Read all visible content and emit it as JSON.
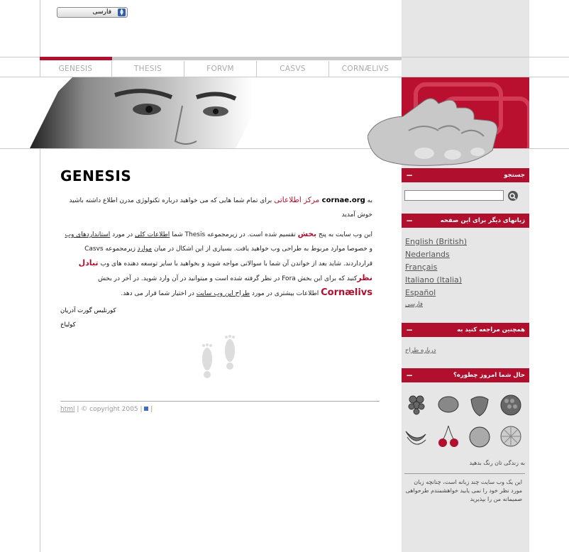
{
  "language_select": {
    "value": "فارسی"
  },
  "nav": {
    "items": [
      {
        "label": "GENESIS",
        "active": true
      },
      {
        "label": "THESIS",
        "active": false
      },
      {
        "label": "FORVM",
        "active": false
      },
      {
        "label": "CASVS",
        "active": false
      },
      {
        "label": "CORNÆLIVS",
        "active": false
      }
    ]
  },
  "main": {
    "title": "GENESIS",
    "intro": {
      "prefix": "به ",
      "site": "cornae.org",
      "red": " مرکز اطلاعاتی",
      "rest": " برای تمام شما هایی که می خواهید درباره تکنولوژی مدرن اطلاع داشته باشید خوش آمدید"
    },
    "p1": {
      "a": "این وب سایت به پنج ",
      "red1": "بخش",
      "b": " تقسیم شده است.  در زیرمجموعه Thesis شما ",
      "link1": "اطلاعات کلی",
      "c": " در مورد ",
      "link2": "استانداردهای وب",
      "d": " و خصوصا موارد مربوط به طراحی وب خواهید یافت. بسیاری از این اشکال در میان ",
      "link3": "موارد",
      "e": " زیرمجموعه Casvs قرارداردند. شاید بعد از خواندن آن شما با سوالاتی مواجه شوید و بخواهید با سایر توسعه دهنده های وب ",
      "red2": "تبادل نظر",
      "f": "کنید که برای این بخش Fora در نظر گرفته شده است و میتوانید در آن وارد شوید. در آخر در بخش ",
      "red3": "Cornælivs",
      "g": " اطلاعات بیشتری در مورد ",
      "link4": "طراح این وب سایت",
      "h": " در اختیار شما قرار می دهد."
    },
    "signature": "کورنلیس گورت آدریان کولباخ",
    "footer": {
      "html": "html",
      "copyright": "© copyright 2005"
    }
  },
  "sidebar": {
    "search": {
      "title": "جستجو",
      "placeholder": ""
    },
    "languages": {
      "title": "زبانهای دیگر برای این صفحه",
      "items": [
        "English (British)",
        "Nederlands",
        "Français",
        "Italiano (Italia)",
        "Español",
        "فارسی"
      ]
    },
    "see_also": {
      "title": "همچنین مراجعه کنید به",
      "link": "درباره طراح"
    },
    "mood": {
      "title": "حال شما امروز چطوره؟",
      "fruits": [
        "grapes-icon",
        "lemon-icon",
        "strawberry-icon",
        "raspberry-icon",
        "bananas-icon",
        "cherries-icon",
        "peach-icon",
        "orange-slice-icon"
      ],
      "caption": "به زندگی تان رنگ بدهید",
      "note": "این یک وب سایت چند زبانه است، چنانچه زبان مورد نظر خود را نمی یابید خواهشمندم طرحواهی صمیمانه من را بپذیرید"
    }
  },
  "colors": {
    "accent": "#b0102e",
    "sidebar": "#e6e6e6",
    "nav": "#c8c8c8"
  }
}
